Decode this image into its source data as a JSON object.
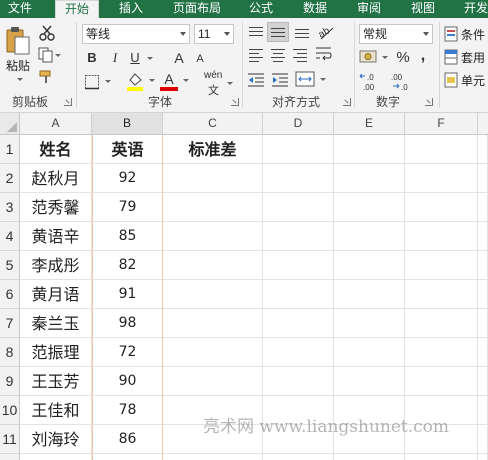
{
  "tabs": [
    "文件",
    "开始",
    "插入",
    "页面布局",
    "公式",
    "数据",
    "审阅",
    "视图",
    "开发"
  ],
  "active_tab": "开始",
  "ribbon": {
    "clipboard": {
      "paste_label": "粘贴",
      "group_label": "剪贴板"
    },
    "font": {
      "font_name": "等线",
      "font_size": "11",
      "bold": "B",
      "italic": "I",
      "underline": "U",
      "grow": "A",
      "shrink": "A",
      "font_color": "A",
      "phonetic": "wén",
      "group_label": "字体",
      "highlight_color": "#ffff00",
      "font_color_value": "#ff0000"
    },
    "alignment": {
      "group_label": "对齐方式"
    },
    "number": {
      "format": "常规",
      "percent": "%",
      "comma": ",",
      "inc_decimal": "←.0\n.00",
      "dec_decimal": ".00\n→.0",
      "group_label": "数字"
    },
    "styles": {
      "conditional": "条件",
      "table": "套用",
      "cell": "单元"
    }
  },
  "grid": {
    "columns": [
      "A",
      "B",
      "C",
      "D",
      "E",
      "F"
    ],
    "selected_column": "B",
    "rows": [
      {
        "num": "1",
        "a": "姓名",
        "b": "英语",
        "c": "标准差"
      },
      {
        "num": "2",
        "a": "赵秋月",
        "b": "92"
      },
      {
        "num": "3",
        "a": "范秀馨",
        "b": "79"
      },
      {
        "num": "4",
        "a": "黄语辛",
        "b": "85"
      },
      {
        "num": "5",
        "a": "李成彤",
        "b": "82"
      },
      {
        "num": "6",
        "a": "黄月语",
        "b": "91"
      },
      {
        "num": "7",
        "a": "秦兰玉",
        "b": "98"
      },
      {
        "num": "8",
        "a": "范振理",
        "b": "72"
      },
      {
        "num": "9",
        "a": "王玉芳",
        "b": "90"
      },
      {
        "num": "10",
        "a": "王佳和",
        "b": "78"
      },
      {
        "num": "11",
        "a": "刘海玲",
        "b": "86"
      }
    ]
  },
  "watermark": "亮术网 www.liangshunet.com"
}
